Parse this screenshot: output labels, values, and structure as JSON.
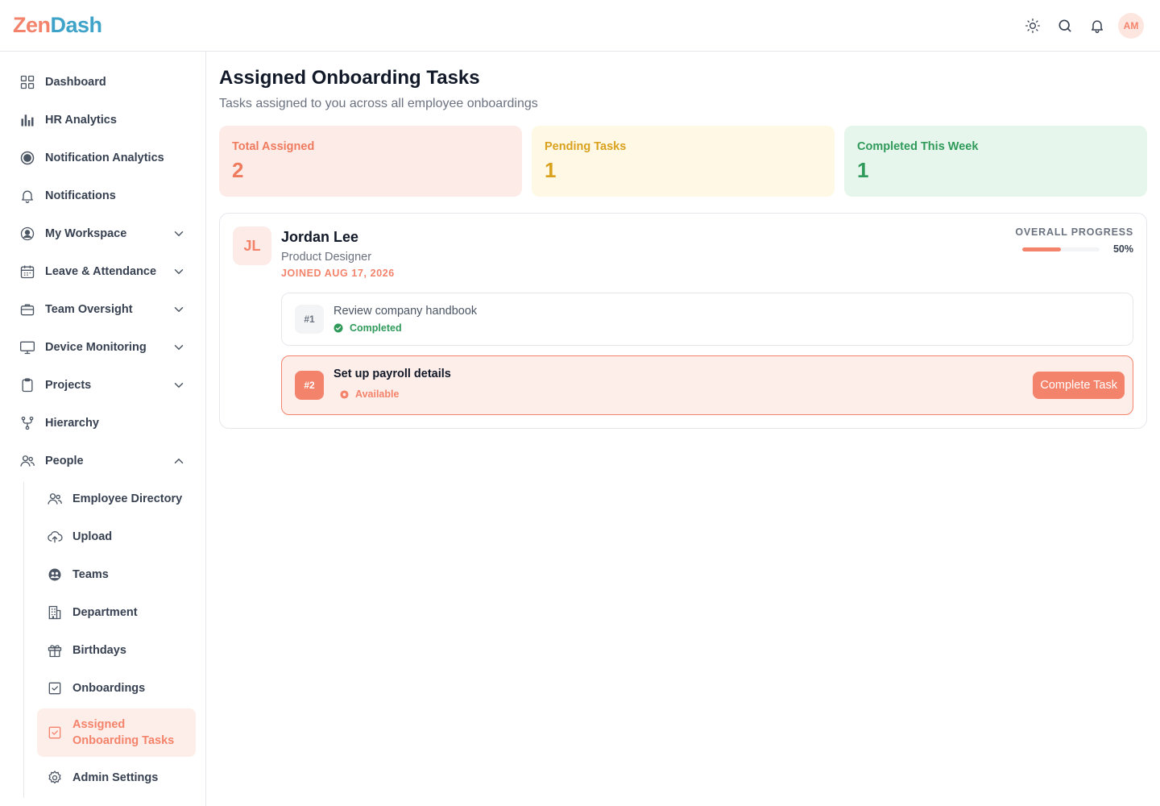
{
  "app": {
    "logo_part1": "Zen",
    "logo_part2": "Dash",
    "user_initials": "AM"
  },
  "header_icons": [
    "theme-sun-icon",
    "search-icon",
    "bell-icon"
  ],
  "sidebar": {
    "items": [
      {
        "label": "Dashboard",
        "icon": "grid-icon"
      },
      {
        "label": "HR Analytics",
        "icon": "bar-chart-icon"
      },
      {
        "label": "Notification Analytics",
        "icon": "target-icon"
      },
      {
        "label": "Notifications",
        "icon": "bell-icon"
      },
      {
        "label": "My Workspace",
        "icon": "user-circle-icon",
        "expandable": true
      },
      {
        "label": "Leave & Attendance",
        "icon": "calendar-icon",
        "expandable": true
      },
      {
        "label": "Team Oversight",
        "icon": "briefcase-icon",
        "expandable": true
      },
      {
        "label": "Device Monitoring",
        "icon": "monitor-icon",
        "expandable": true
      },
      {
        "label": "Projects",
        "icon": "clipboard-icon",
        "expandable": true
      },
      {
        "label": "Hierarchy",
        "icon": "hierarchy-icon"
      },
      {
        "label": "People",
        "icon": "users-icon",
        "expandable": true,
        "expanded": true
      }
    ],
    "people_sub": [
      {
        "label": "Employee Directory",
        "icon": "users-icon"
      },
      {
        "label": "Upload",
        "icon": "cloud-upload-icon"
      },
      {
        "label": "Teams",
        "icon": "teams-icon"
      },
      {
        "label": "Department",
        "icon": "building-icon"
      },
      {
        "label": "Birthdays",
        "icon": "gift-icon"
      },
      {
        "label": "Onboardings",
        "icon": "check-square-icon"
      },
      {
        "label": "Assigned Onboarding Tasks",
        "icon": "check-square-icon",
        "active": true
      },
      {
        "label": "Admin Settings",
        "icon": "gear-icon"
      }
    ]
  },
  "page": {
    "title": "Assigned Onboarding Tasks",
    "subtitle": "Tasks assigned to you across all employee onboardings"
  },
  "stats": [
    {
      "label": "Total Assigned",
      "value": "2",
      "color": "#ef7b5f"
    },
    {
      "label": "Pending Tasks",
      "value": "1",
      "color": "#d9a11d"
    },
    {
      "label": "Completed This Week",
      "value": "1",
      "color": "#2f9a5a"
    }
  ],
  "employee": {
    "initials": "JL",
    "name": "Jordan Lee",
    "role": "Product Designer",
    "joined": "JOINED AUG 17, 2026",
    "progress_label": "OVERALL PROGRESS",
    "progress_percent_text": "50%",
    "progress_fraction": 0.5,
    "tasks": [
      {
        "num": "#1",
        "title": "Review company handbook",
        "status": "Completed"
      },
      {
        "num": "#2",
        "title": "Set up payroll details",
        "status": "Available",
        "action": "Complete Task"
      }
    ]
  },
  "colors": {
    "accent": "#f4836b",
    "accent_bg": "#fdeeea",
    "success": "#2f9a5a",
    "warning": "#d9a11d"
  }
}
